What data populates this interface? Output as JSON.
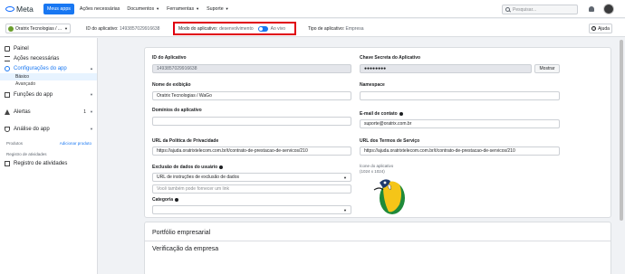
{
  "topbar": {
    "logo": "Meta",
    "nav": [
      {
        "label": "Meus apps",
        "active": true,
        "dropdown": false
      },
      {
        "label": "Ações necessárias",
        "active": false,
        "dropdown": false
      },
      {
        "label": "Documentos",
        "active": false,
        "dropdown": true
      },
      {
        "label": "Ferramentas",
        "active": false,
        "dropdown": true
      },
      {
        "label": "Suporte",
        "active": false,
        "dropdown": true
      }
    ],
    "search_placeholder": "Pesquisar..."
  },
  "subbar": {
    "app_name": "Oratrix Tecnologias / ...",
    "app_id_label": "ID do aplicativo:",
    "app_id_value": "1493857029916638",
    "mode_label": "Modo do aplicativo:",
    "mode_value": "desenvolvimento",
    "mode_live": "Ao vivo",
    "app_type_label": "Tipo de aplicativo:",
    "app_type_value": "Empresa",
    "help_label": "Ajuda"
  },
  "sidebar": {
    "items": [
      {
        "label": "Painel",
        "icon": "grid-icon"
      },
      {
        "label": "Ações necessárias",
        "icon": "list-icon"
      },
      {
        "label": "Configurações do app",
        "icon": "gear-icon",
        "active": true
      },
      {
        "label": "Funções do app",
        "icon": "users-icon"
      },
      {
        "label": "Alertas",
        "icon": "alert-icon",
        "badge": "1"
      },
      {
        "label": "Análise do app",
        "icon": "flask-icon"
      }
    ],
    "sub_items": [
      "Básico",
      "Avançado"
    ],
    "products_label": "Produtos",
    "add_product": "Adicionar produto",
    "activity_small": "Registro de atividades",
    "activity": "Registro de atividades"
  },
  "form": {
    "app_id_label": "ID do Aplicativo",
    "app_id_value": "1493857029916638",
    "secret_label": "Chave Secreta do Aplicativo",
    "secret_value": "●●●●●●●●",
    "show_button": "Mostrar",
    "display_name_label": "Nome de exibição",
    "display_name_value": "Oratrix Tecnologias / WaGo",
    "namespace_label": "Namespace",
    "namespace_value": "",
    "domains_label": "Domínios do aplicativo",
    "domains_value": "",
    "contact_email_label": "E-mail de contato",
    "contact_email_value": "suporte@oratrix.com.br",
    "privacy_url_label": "URL da Política de Privacidade",
    "privacy_url_value": "https://ajuda.oratrixtelecom.com.br/t/contrato-de-prestacao-de-servicos/210",
    "terms_url_label": "URL dos Termos de Serviço",
    "terms_url_value": "https://ajuda.oratrixtelecom.com.br/t/contrato-de-prestacao-de-servicos/210",
    "data_deletion_label": "Exclusão de dados do usuário",
    "data_deletion_select": "URL de instruções de exclusão de dados",
    "data_deletion_placeholder": "Você também pode fornecer um link",
    "app_icon_label": "Ícone do aplicativo (1024 x 1024)",
    "category_label": "Categoria",
    "category_value": ""
  },
  "sections": {
    "business_portfolio": "Portfólio empresarial",
    "business_verification": "Verificação da empresa"
  }
}
